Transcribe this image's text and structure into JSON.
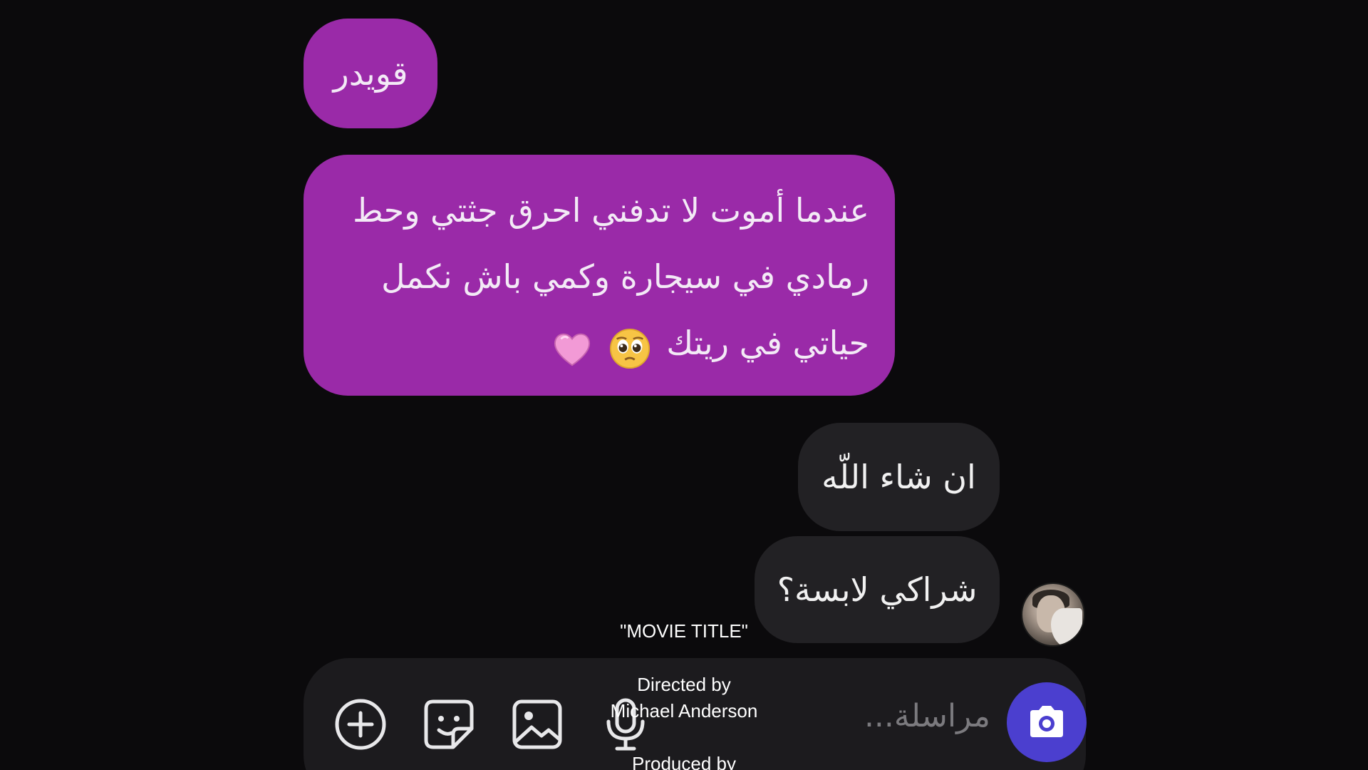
{
  "messages": [
    {
      "side": "sent",
      "text": "قويدر"
    },
    {
      "side": "sent",
      "lines": [
        "عندما أموت لا تدفني احرق جثتي وحط",
        "رمادي في سيجارة وكمي باش نكمل",
        "حياتي في ريتك"
      ],
      "emojis": [
        "pleading-face",
        "pink-heart"
      ]
    },
    {
      "side": "received",
      "text": "ان شاء اللّه"
    },
    {
      "side": "received",
      "text": "شراكي لابسة؟"
    }
  ],
  "composer": {
    "placeholder": "مراسلة..."
  },
  "overlay": {
    "title": "\"MOVIE TITLE\"",
    "directed_by": "Directed by",
    "director": "Michael Anderson",
    "produced_by": "Produced by"
  },
  "colors": {
    "sent_bubble": "#9a2aa8",
    "received_bubble": "#222124",
    "camera_button": "#4b3fcf",
    "background": "#0b0a0c"
  }
}
